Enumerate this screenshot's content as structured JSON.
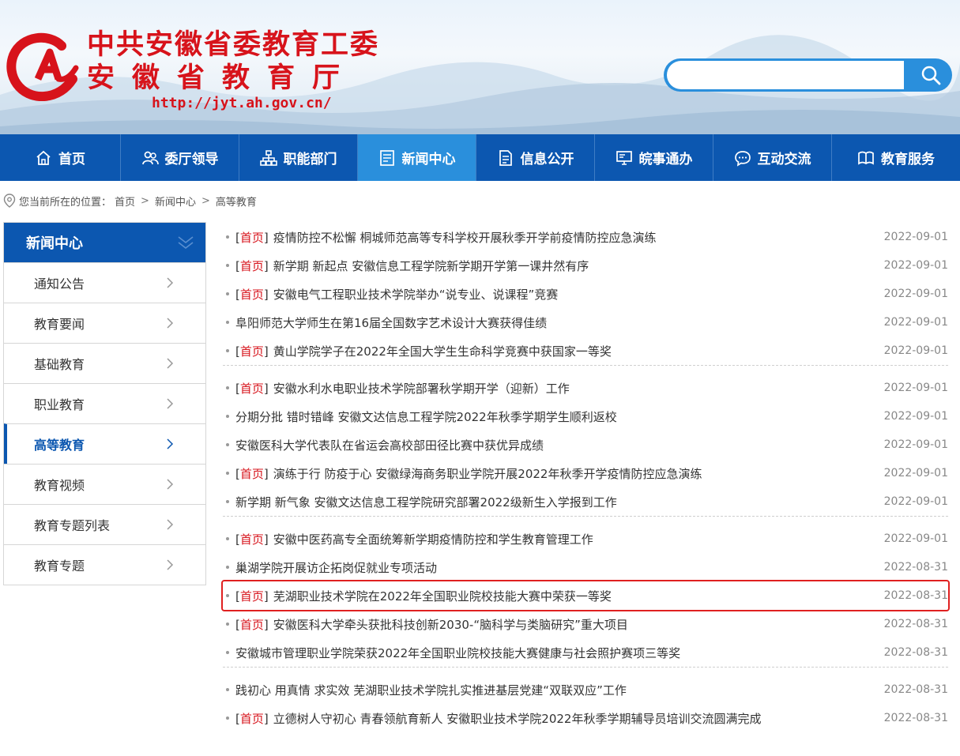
{
  "header": {
    "title_line1": "中共安徽省委教育工委",
    "title_line2": "安徽省教育厅",
    "url": "http://jyt.ah.gov.cn/",
    "search_placeholder": ""
  },
  "nav": [
    {
      "label": "首页",
      "icon": "home-icon"
    },
    {
      "label": "委厅领导",
      "icon": "people-icon"
    },
    {
      "label": "职能部门",
      "icon": "org-chart-icon"
    },
    {
      "label": "新闻中心",
      "icon": "news-icon",
      "active": true
    },
    {
      "label": "信息公开",
      "icon": "document-icon"
    },
    {
      "label": "皖事通办",
      "icon": "monitor-icon"
    },
    {
      "label": "互动交流",
      "icon": "chat-icon"
    },
    {
      "label": "教育服务",
      "icon": "book-icon"
    }
  ],
  "breadcrumb": {
    "prefix": "您当前所在的位置：",
    "items": [
      "首页",
      "新闻中心",
      "高等教育"
    ],
    "sep": ">"
  },
  "sidebar": {
    "title": "新闻中心",
    "items": [
      {
        "label": "通知公告"
      },
      {
        "label": "教育要闻"
      },
      {
        "label": "基础教育"
      },
      {
        "label": "职业教育"
      },
      {
        "label": "高等教育",
        "active": true
      },
      {
        "label": "教育视频"
      },
      {
        "label": "教育专题列表"
      },
      {
        "label": "教育专题"
      }
    ]
  },
  "news": {
    "tag_text": "首页",
    "groups": [
      [
        {
          "tag": true,
          "title": "疫情防控不松懈 桐城师范高等专科学校开展秋季开学前疫情防控应急演练",
          "date": "2022-09-01"
        },
        {
          "tag": true,
          "title": "新学期 新起点 安徽信息工程学院新学期开学第一课井然有序",
          "date": "2022-09-01"
        },
        {
          "tag": true,
          "title": "安徽电气工程职业技术学院举办“说专业、说课程”竞赛",
          "date": "2022-09-01"
        },
        {
          "tag": false,
          "title": "阜阳师范大学师生在第16届全国数字艺术设计大赛获得佳绩",
          "date": "2022-09-01"
        },
        {
          "tag": true,
          "title": "黄山学院学子在2022年全国大学生生命科学竞赛中获国家一等奖",
          "date": "2022-09-01"
        }
      ],
      [
        {
          "tag": true,
          "title": "安徽水利水电职业技术学院部署秋学期开学（迎新）工作",
          "date": "2022-09-01"
        },
        {
          "tag": false,
          "title": "分期分批 错时错峰 安徽文达信息工程学院2022年秋季学期学生顺利返校",
          "date": "2022-09-01"
        },
        {
          "tag": false,
          "title": "安徽医科大学代表队在省运会高校部田径比赛中获优异成绩",
          "date": "2022-09-01"
        },
        {
          "tag": true,
          "title": "演练于行 防疫于心 安徽绿海商务职业学院开展2022年秋季开学疫情防控应急演练",
          "date": "2022-09-01"
        },
        {
          "tag": false,
          "title": "新学期 新气象 安徽文达信息工程学院研究部署2022级新生入学报到工作",
          "date": "2022-09-01"
        }
      ],
      [
        {
          "tag": true,
          "title": "安徽中医药高专全面统筹新学期疫情防控和学生教育管理工作",
          "date": "2022-09-01"
        },
        {
          "tag": false,
          "title": "巢湖学院开展访企拓岗促就业专项活动",
          "date": "2022-08-31"
        },
        {
          "tag": true,
          "title": "芜湖职业技术学院在2022年全国职业院校技能大赛中荣获一等奖",
          "date": "2022-08-31",
          "highlight": true
        },
        {
          "tag": true,
          "title": "安徽医科大学牵头获批科技创新2030-“脑科学与类脑研究”重大项目",
          "date": "2022-08-31"
        },
        {
          "tag": false,
          "title": "安徽城市管理职业学院荣获2022年全国职业院校技能大赛健康与社会照护赛项三等奖",
          "date": "2022-08-31"
        }
      ],
      [
        {
          "tag": false,
          "title": "践初心 用真情 求实效 芜湖职业技术学院扎实推进基层党建“双联双应”工作",
          "date": "2022-08-31"
        },
        {
          "tag": true,
          "title": "立德树人守初心 青春领航育新人 安徽职业技术学院2022年秋季学期辅导员培训交流圆满完成",
          "date": "2022-08-31"
        }
      ]
    ]
  }
}
